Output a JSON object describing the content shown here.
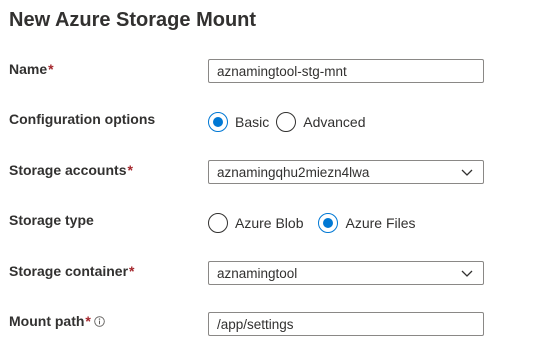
{
  "title": "New Azure Storage Mount",
  "required_marker": "*",
  "colors": {
    "accent": "#0078d4",
    "required": "#a4262c",
    "border": "#8a8886"
  },
  "form": {
    "name": {
      "label": "Name",
      "value": "aznamingtool-stg-mnt"
    },
    "configuration": {
      "label": "Configuration options",
      "options": [
        "Basic",
        "Advanced"
      ],
      "selected": "Basic"
    },
    "storage_accounts": {
      "label": "Storage accounts",
      "value": "aznamingqhu2miezn4lwa",
      "icon": "chevron-down-icon"
    },
    "storage_type": {
      "label": "Storage type",
      "options": [
        "Azure Blob",
        "Azure Files"
      ],
      "selected": "Azure Files"
    },
    "storage_container": {
      "label": "Storage container",
      "value": "aznamingtool",
      "icon": "chevron-down-icon"
    },
    "mount_path": {
      "label": "Mount path",
      "value": "/app/settings",
      "icon": "info-icon"
    }
  }
}
